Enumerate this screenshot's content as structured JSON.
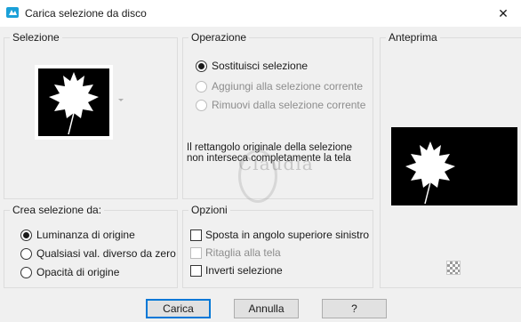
{
  "window": {
    "title": "Carica selezione da disco",
    "close_glyph": "✕"
  },
  "selezione": {
    "legend": "Selezione"
  },
  "operazione": {
    "legend": "Operazione",
    "options": [
      {
        "label": "Sostituisci selezione",
        "checked": true,
        "enabled": true
      },
      {
        "label": "Aggiungi alla selezione corrente",
        "checked": false,
        "enabled": false
      },
      {
        "label": "Rimuovi dalla selezione corrente",
        "checked": false,
        "enabled": false
      }
    ],
    "message": "Il rettangolo originale della selezione non interseca completamente la tela"
  },
  "anteprima": {
    "legend": "Anteprima"
  },
  "crea": {
    "legend": "Crea selezione da:",
    "options": [
      {
        "label": "Luminanza di origine",
        "checked": true
      },
      {
        "label": "Qualsiasi val. diverso da zero",
        "checked": false
      },
      {
        "label": "Opacità di origine",
        "checked": false
      }
    ]
  },
  "opzioni": {
    "legend": "Opzioni",
    "checks": [
      {
        "label": "Sposta in angolo superiore sinistro",
        "checked": false,
        "enabled": true
      },
      {
        "label": "Ritaglia alla tela",
        "checked": false,
        "enabled": false
      },
      {
        "label": "Inverti selezione",
        "checked": false,
        "enabled": true
      }
    ]
  },
  "buttons": {
    "load": "Carica",
    "cancel": "Annulla",
    "help": "?"
  },
  "watermark": "Claudia"
}
